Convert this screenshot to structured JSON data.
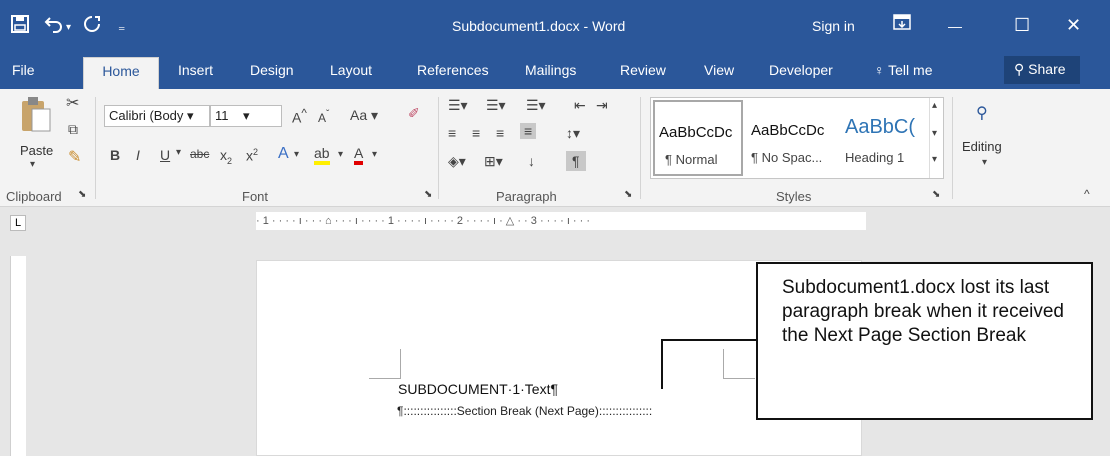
{
  "titlebar": {
    "title": "Subdocument1.docx - Word",
    "sign_in": "Sign in",
    "save_icon": "save-icon",
    "undo_icon": "undo-icon",
    "redo_icon": "redo-icon",
    "customize_icon": "quick-access-customize-icon",
    "ribbon_display_icon": "ribbon-display-options-icon",
    "minimize_glyph": "—",
    "maximize_glyph": "☐",
    "close_glyph": "✕",
    "color": "#2b579a"
  },
  "tabs": {
    "items": [
      "File",
      "Home",
      "Insert",
      "Design",
      "Layout",
      "References",
      "Mailings",
      "Review",
      "View",
      "Developer"
    ],
    "tell_me": "Tell me",
    "share": "Share",
    "active": "Home"
  },
  "ribbon": {
    "clipboard": {
      "paste": "Paste",
      "label": "Clipboard"
    },
    "font": {
      "family": "Calibri (Body",
      "size": "11",
      "label": "Font",
      "case_button": "Aa"
    },
    "paragraph": {
      "label": "Paragraph"
    },
    "styles": {
      "label": "Styles",
      "items": [
        {
          "sample": "AaBbCcDc",
          "name": "¶ Normal"
        },
        {
          "sample": "AaBbCcDc",
          "name": "¶ No Spac..."
        },
        {
          "sample": "AaBbC(",
          "name": "Heading 1"
        }
      ]
    },
    "editing": {
      "label": "Editing"
    }
  },
  "ruler": {
    "text": "· 1 · · · · ı · · · ⌂ · · · ı · · · · 1 · · · · ı · · · · 2 · · · · ı · △ · · 3 · · · · ı · · ·",
    "tab_selector": "L"
  },
  "document": {
    "body_text": "SUBDOCUMENT·1·Text¶",
    "section_break": "¶::::::::::::::::Section Break (Next Page)::::::::::::::::"
  },
  "callout": {
    "text": "Subdocument1.docx lost its last paragraph break when it received the Next Page Section Break"
  }
}
